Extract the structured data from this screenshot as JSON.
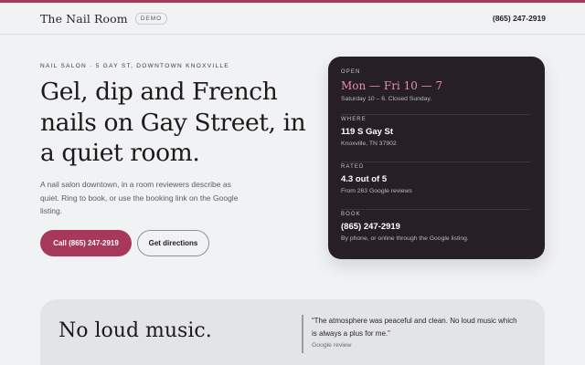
{
  "header": {
    "brand_name": "The Nail Room",
    "badge": "DEMO",
    "phone": "(865) 247-2919"
  },
  "hero": {
    "eyebrow": "NAIL SALON · 5 GAY ST, DOWNTOWN KNOXVILLE",
    "headline": "Gel, dip and French nails on Gay Street, in a quiet room.",
    "subtext": "A nail salon downtown, in a room reviewers describe as quiet. Ring to book, or use the booking link on the Google listing.",
    "call_button": "Call (865) 247-2919",
    "directions_button": "Get directions"
  },
  "info_card": {
    "open": {
      "label": "OPEN",
      "value": "Mon — Fri 10 — 7",
      "sub": "Saturday 10 – 6. Closed Sunday."
    },
    "where": {
      "label": "WHERE",
      "value": "119 S Gay St",
      "sub": "Knoxville, TN 37902"
    },
    "rated": {
      "label": "RATED",
      "value": "4.3 out of 5",
      "sub": "From 263 Google reviews"
    },
    "book": {
      "label": "BOOK",
      "value": "(865) 247-2919",
      "sub": "By phone, or online through the Google listing."
    }
  },
  "quote_band": {
    "title": "No loud music.",
    "quote": "“The atmosphere was peaceful and clean. No loud music which is always a plus for me.”",
    "source": "Google review"
  },
  "colors": {
    "accent": "#a8385a",
    "card_bg": "#262024",
    "accent_light": "#e48fae"
  }
}
